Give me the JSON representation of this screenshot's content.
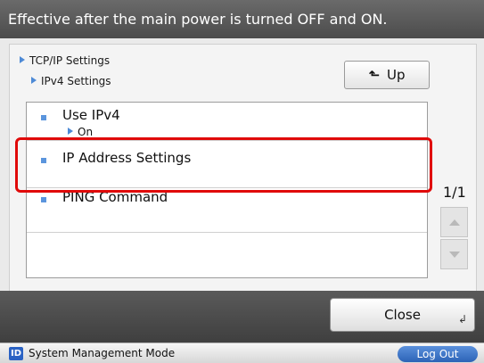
{
  "banner": {
    "message": "Effective after the main power is turned OFF and ON."
  },
  "breadcrumb": {
    "level1": "TCP/IP Settings",
    "level2": "IPv4 Settings"
  },
  "toolbar": {
    "up_label": "Up"
  },
  "list": {
    "items": [
      {
        "label": "Use IPv4",
        "value": "On"
      },
      {
        "label": "IP Address Settings",
        "value": ""
      },
      {
        "label": "PING Command",
        "value": ""
      },
      {
        "label": "",
        "value": ""
      }
    ]
  },
  "pager": {
    "indicator": "1/1"
  },
  "footer": {
    "close_label": "Close"
  },
  "status_bar": {
    "badge": "ID",
    "mode": "System Management Mode",
    "logout_label": "Log Out"
  },
  "colors": {
    "highlight": "#e00a0a",
    "accent": "#4d8ad6",
    "logout": "#2c63b6"
  },
  "icons": {
    "up": "up-return-arrow",
    "scroll_up": "triangle-up",
    "scroll_down": "triangle-down",
    "close_enter": "enter-corner-arrow"
  }
}
